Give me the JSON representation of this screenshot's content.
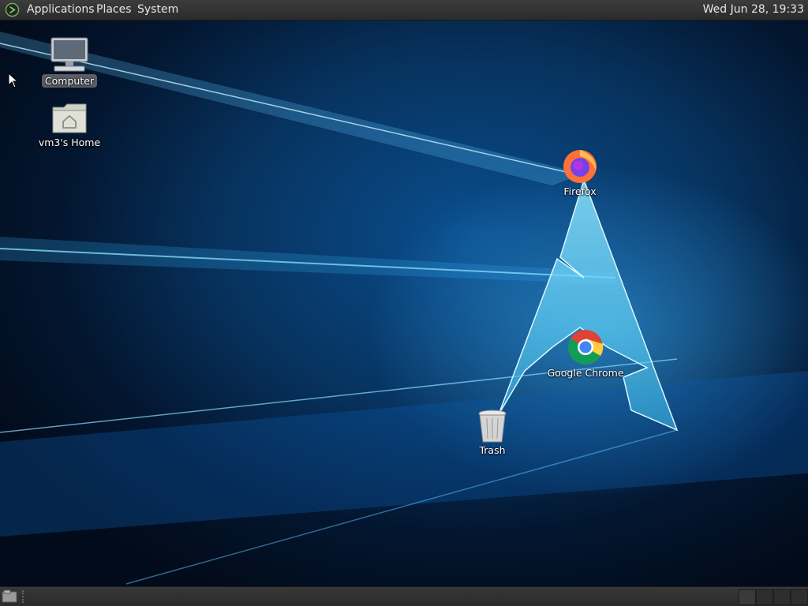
{
  "top_panel": {
    "menus": [
      "Applications",
      "Places",
      "System"
    ],
    "clock": "Wed Jun 28, 19:33"
  },
  "desktop_icons": [
    {
      "label": "Computer",
      "icon": "computer-icon",
      "selected": true
    },
    {
      "label": "vm3's Home",
      "icon": "home-folder-icon"
    },
    {
      "label": "Firefox",
      "icon": "firefox-icon"
    },
    {
      "label": "Google Chrome",
      "icon": "chrome-icon"
    },
    {
      "label": "Trash",
      "icon": "trash-icon"
    }
  ],
  "colors": {
    "panel": "#2b2b2b",
    "wallpaper_accent": "#3aa8e8",
    "wallpaper_dark": "#031630"
  }
}
